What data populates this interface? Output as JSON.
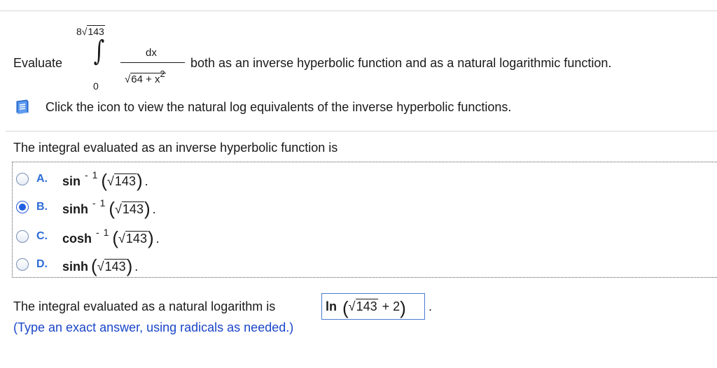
{
  "question": {
    "evaluate_label": "Evaluate",
    "integral_symbol": "∫",
    "upper_limit_coef": "8",
    "upper_limit_radical": "143",
    "lower_limit": "0",
    "numerator": "dx",
    "denominator_radicand": "64 + x",
    "denominator_exponent": "2",
    "rest": "both as an inverse hyperbolic function and as a natural logarithmic function."
  },
  "hint": {
    "icon": "book-icon",
    "text": "Click the icon to view the natural log equivalents of the inverse hyperbolic functions."
  },
  "part1": {
    "prompt": "The integral evaluated as an inverse hyperbolic function is",
    "choices": [
      {
        "letter": "A.",
        "fn": "sin",
        "exp": "- 1",
        "radicand": "143",
        "selected": false
      },
      {
        "letter": "B.",
        "fn": "sinh",
        "exp": "- 1",
        "radicand": "143",
        "selected": true
      },
      {
        "letter": "C.",
        "fn": "cosh",
        "exp": "- 1",
        "radicand": "143",
        "selected": false
      },
      {
        "letter": "D.",
        "fn": "sinh",
        "exp": "",
        "radicand": "143",
        "selected": false
      }
    ],
    "sqrt_symbol": "√",
    "open_paren": "(",
    "close_paren": ")",
    "period": "."
  },
  "part2": {
    "prompt": "The integral evaluated as a natural logarithm is",
    "answer_fn": "ln",
    "answer_radicand": "143",
    "answer_tail": "+ 2",
    "after": ".",
    "instruction": "(Type an exact answer, using radicals as needed.)"
  },
  "colors": {
    "letter": "#2d6cd8",
    "instruction": "#1a46c8",
    "radio_selected": "#1f5fe0"
  }
}
